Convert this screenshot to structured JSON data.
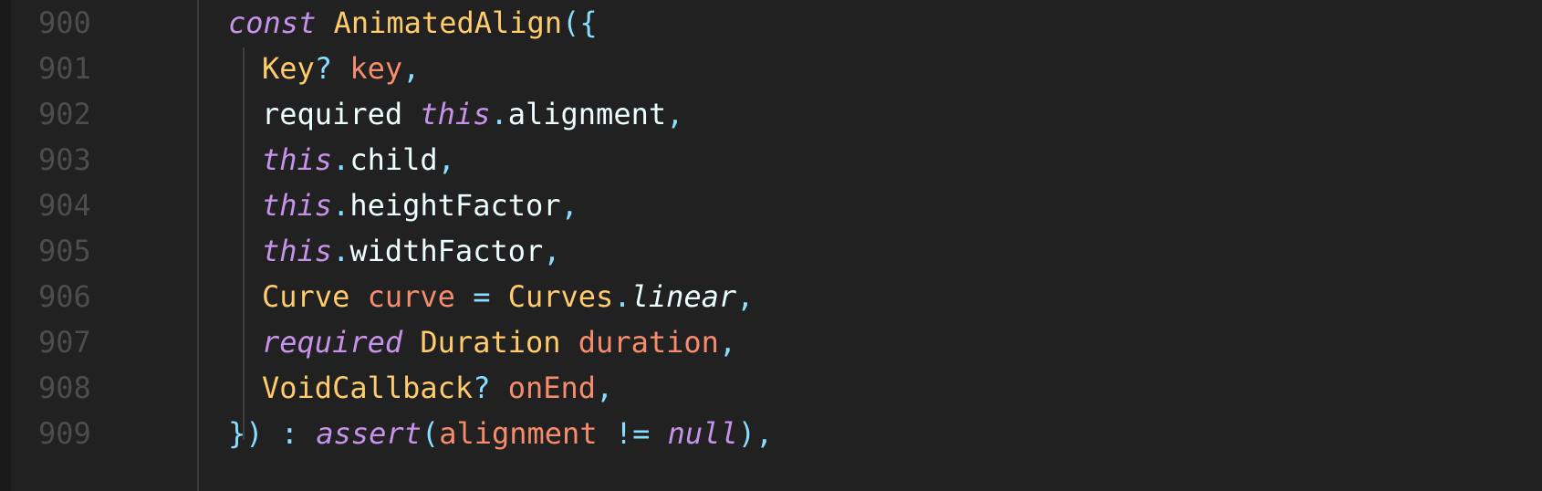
{
  "editor": {
    "colors": {
      "background": "#212121",
      "line_number": "#4d4d4d",
      "keyword": "#c792ea",
      "type": "#ffcb6b",
      "parameter": "#f78c6c",
      "punctuation": "#89ddff",
      "plain": "#eeffff"
    },
    "lines": [
      {
        "number": "900",
        "tokens": [
          {
            "t": "const",
            "c": "kw"
          },
          {
            "t": " ",
            "c": "pl"
          },
          {
            "t": "AnimatedAlign",
            "c": "ty"
          },
          {
            "t": "({",
            "c": "pu"
          }
        ]
      },
      {
        "number": "901",
        "tokens": [
          {
            "t": "Key",
            "c": "ty"
          },
          {
            "t": "?",
            "c": "pu"
          },
          {
            "t": " ",
            "c": "pl"
          },
          {
            "t": "key",
            "c": "pa"
          },
          {
            "t": ",",
            "c": "pu"
          }
        ]
      },
      {
        "number": "902",
        "tokens": [
          {
            "t": "required",
            "c": "pl"
          },
          {
            "t": " ",
            "c": "pl"
          },
          {
            "t": "this",
            "c": "kw"
          },
          {
            "t": ".",
            "c": "pu"
          },
          {
            "t": "alignment",
            "c": "pl"
          },
          {
            "t": ",",
            "c": "pu"
          }
        ]
      },
      {
        "number": "903",
        "tokens": [
          {
            "t": "this",
            "c": "kw"
          },
          {
            "t": ".",
            "c": "pu"
          },
          {
            "t": "child",
            "c": "pl"
          },
          {
            "t": ",",
            "c": "pu"
          }
        ]
      },
      {
        "number": "904",
        "tokens": [
          {
            "t": "this",
            "c": "kw"
          },
          {
            "t": ".",
            "c": "pu"
          },
          {
            "t": "heightFactor",
            "c": "pl"
          },
          {
            "t": ",",
            "c": "pu"
          }
        ]
      },
      {
        "number": "905",
        "tokens": [
          {
            "t": "this",
            "c": "kw"
          },
          {
            "t": ".",
            "c": "pu"
          },
          {
            "t": "widthFactor",
            "c": "pl"
          },
          {
            "t": ",",
            "c": "pu"
          }
        ]
      },
      {
        "number": "906",
        "tokens": [
          {
            "t": "Curve",
            "c": "ty"
          },
          {
            "t": " ",
            "c": "pl"
          },
          {
            "t": "curve",
            "c": "pa"
          },
          {
            "t": " ",
            "c": "pl"
          },
          {
            "t": "=",
            "c": "pu"
          },
          {
            "t": " ",
            "c": "pl"
          },
          {
            "t": "Curves",
            "c": "ty"
          },
          {
            "t": ".",
            "c": "pu"
          },
          {
            "t": "linear",
            "c": "it"
          },
          {
            "t": ",",
            "c": "pu"
          }
        ]
      },
      {
        "number": "907",
        "tokens": [
          {
            "t": "required",
            "c": "kw"
          },
          {
            "t": " ",
            "c": "pl"
          },
          {
            "t": "Duration",
            "c": "ty"
          },
          {
            "t": " ",
            "c": "pl"
          },
          {
            "t": "duration",
            "c": "pa"
          },
          {
            "t": ",",
            "c": "pu"
          }
        ]
      },
      {
        "number": "908",
        "tokens": [
          {
            "t": "VoidCallback",
            "c": "ty"
          },
          {
            "t": "?",
            "c": "pu"
          },
          {
            "t": " ",
            "c": "pl"
          },
          {
            "t": "onEnd",
            "c": "pa"
          },
          {
            "t": ",",
            "c": "pu"
          }
        ]
      },
      {
        "number": "909",
        "tokens": [
          {
            "t": "})",
            "c": "pu"
          },
          {
            "t": " ",
            "c": "pl"
          },
          {
            "t": ":",
            "c": "pu"
          },
          {
            "t": " ",
            "c": "pl"
          },
          {
            "t": "assert",
            "c": "kw"
          },
          {
            "t": "(",
            "c": "pu"
          },
          {
            "t": "alignment",
            "c": "pa"
          },
          {
            "t": " ",
            "c": "pl"
          },
          {
            "t": "!=",
            "c": "pu"
          },
          {
            "t": " ",
            "c": "pl"
          },
          {
            "t": "null",
            "c": "kw"
          },
          {
            "t": "),",
            "c": "pu"
          }
        ]
      }
    ]
  }
}
